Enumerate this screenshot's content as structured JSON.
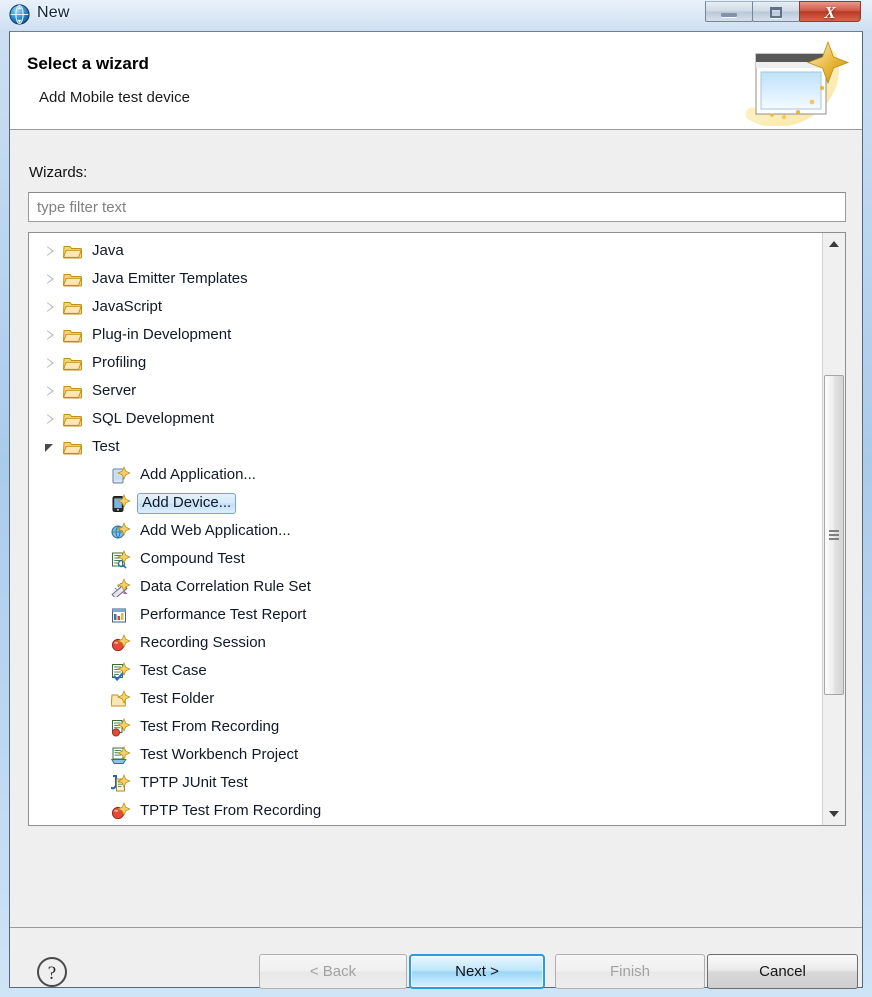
{
  "window": {
    "title": "New",
    "icon": "eclipse-new-icon",
    "controls": {
      "minimize_label": "–",
      "maximize_label": "□",
      "close_label": "X"
    }
  },
  "banner": {
    "title": "Select a wizard",
    "subtitle": "Add Mobile test device",
    "icon": "wizard-sparkle-icon"
  },
  "filter": {
    "label": "Wizards:",
    "value": "",
    "placeholder": "type filter text"
  },
  "tree": {
    "rows": [
      {
        "label": "Java",
        "level": 0,
        "icon": "folder-icon",
        "state": "collapsed",
        "selected": false
      },
      {
        "label": "Java Emitter Templates",
        "level": 0,
        "icon": "folder-icon",
        "state": "collapsed",
        "selected": false
      },
      {
        "label": "JavaScript",
        "level": 0,
        "icon": "folder-icon",
        "state": "collapsed",
        "selected": false
      },
      {
        "label": "Plug-in Development",
        "level": 0,
        "icon": "folder-icon",
        "state": "collapsed",
        "selected": false
      },
      {
        "label": "Profiling",
        "level": 0,
        "icon": "folder-icon",
        "state": "collapsed",
        "selected": false
      },
      {
        "label": "Server",
        "level": 0,
        "icon": "folder-icon",
        "state": "collapsed",
        "selected": false
      },
      {
        "label": "SQL Development",
        "level": 0,
        "icon": "folder-icon",
        "state": "collapsed",
        "selected": false
      },
      {
        "label": "Test",
        "level": 0,
        "icon": "folder-icon",
        "state": "expanded",
        "selected": false
      },
      {
        "label": "Add Application...",
        "level": 1,
        "icon": "add-application-icon",
        "state": "leaf",
        "selected": false
      },
      {
        "label": "Add Device...",
        "level": 1,
        "icon": "add-device-icon",
        "state": "leaf",
        "selected": true
      },
      {
        "label": "Add Web Application...",
        "level": 1,
        "icon": "add-web-application-icon",
        "state": "leaf",
        "selected": false
      },
      {
        "label": "Compound Test",
        "level": 1,
        "icon": "compound-test-icon",
        "state": "leaf",
        "selected": false
      },
      {
        "label": "Data Correlation Rule Set",
        "level": 1,
        "icon": "rule-set-icon",
        "state": "leaf",
        "selected": false
      },
      {
        "label": "Performance Test Report",
        "level": 1,
        "icon": "report-icon",
        "state": "leaf",
        "selected": false
      },
      {
        "label": "Recording Session",
        "level": 1,
        "icon": "recording-session-icon",
        "state": "leaf",
        "selected": false
      },
      {
        "label": "Test Case",
        "level": 1,
        "icon": "test-case-icon",
        "state": "leaf",
        "selected": false
      },
      {
        "label": "Test Folder",
        "level": 1,
        "icon": "test-folder-icon",
        "state": "leaf",
        "selected": false
      },
      {
        "label": "Test From Recording",
        "level": 1,
        "icon": "test-from-recording-icon",
        "state": "leaf",
        "selected": false
      },
      {
        "label": "Test Workbench Project",
        "level": 1,
        "icon": "workbench-project-icon",
        "state": "leaf",
        "selected": false
      },
      {
        "label": "TPTP JUnit Test",
        "level": 1,
        "icon": "junit-test-icon",
        "state": "leaf",
        "selected": false
      },
      {
        "label": "TPTP Test From Recording",
        "level": 1,
        "icon": "recording-session-icon",
        "state": "leaf",
        "selected": false
      }
    ]
  },
  "scrollbar": {
    "up_arrow": "scroll-up-arrow",
    "down_arrow": "scroll-down-arrow",
    "thumb": "scroll-thumb"
  },
  "footer": {
    "help_label": "?",
    "back_label": "< Back",
    "next_label": "Next >",
    "finish_label": "Finish",
    "cancel_label": "Cancel"
  },
  "colors": {
    "accent_blue": "#2f9bdb",
    "selection_blue": "#c3e0f7",
    "dialog_bg": "#efefef",
    "close_red": "#b83a24",
    "folder_yellow": "#f0b84b"
  }
}
